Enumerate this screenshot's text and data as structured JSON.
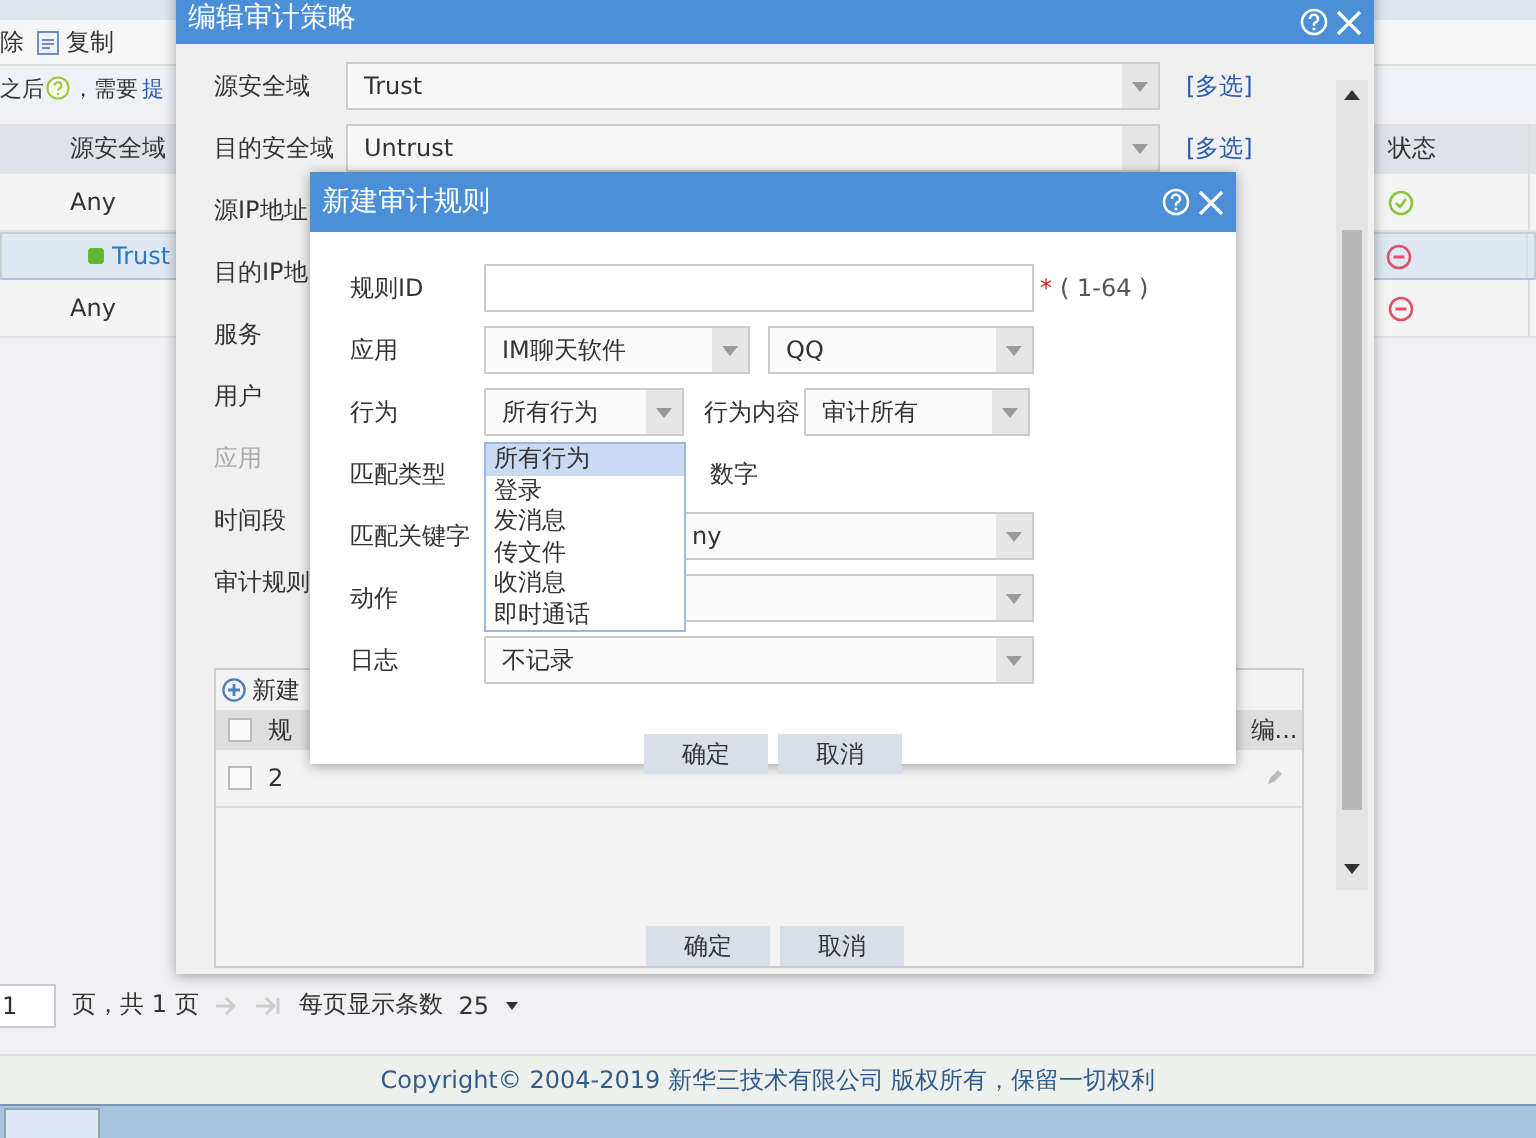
{
  "page": {
    "toolbar": [
      {
        "kind": "text",
        "label": "除"
      },
      {
        "kind": "copy",
        "label": "复制"
      }
    ],
    "notice": {
      "before": "之后",
      "after": "，需要",
      "link": "提"
    },
    "table": {
      "columns": [
        "源安全域",
        "状态"
      ],
      "rows": [
        {
          "zone": "Any",
          "zone_dot": false,
          "enabled": true,
          "selected": false
        },
        {
          "zone": "Trust",
          "zone_dot": true,
          "enabled": false,
          "selected": true
        },
        {
          "zone": "Any",
          "zone_dot": false,
          "enabled": false,
          "selected": false
        }
      ]
    },
    "pager": {
      "page": "1",
      "total": "页，共 1 页",
      "per_page_label": "每页显示条数",
      "per_page": "25"
    },
    "footer": "Copyright© 2004-2019 新华三技术有限公司 版权所有，保留一切权利"
  },
  "edit_dialog": {
    "title": "编辑审计策略",
    "fields": [
      {
        "label": "源安全域",
        "kind": "select",
        "value": "Trust",
        "link": "[多选]",
        "disabled": false
      },
      {
        "label": "目的安全域",
        "kind": "select",
        "value": "Untrust",
        "link": "[多选]",
        "disabled": false
      },
      {
        "label": "源IP地址",
        "kind": "label",
        "disabled": false
      },
      {
        "label": "目的IP地",
        "kind": "label",
        "disabled": false
      },
      {
        "label": "服务",
        "kind": "label",
        "disabled": false
      },
      {
        "label": "用户",
        "kind": "label",
        "disabled": false
      },
      {
        "label": "应用",
        "kind": "label",
        "disabled": true
      },
      {
        "label": "时间段",
        "kind": "label",
        "disabled": false
      },
      {
        "label": "审计规则",
        "kind": "label",
        "disabled": false
      }
    ],
    "rules_table": {
      "new_label": "新建",
      "columns": [
        "规",
        "编..."
      ],
      "header_checked": false,
      "rows": [
        {
          "id": "2",
          "checked": false
        }
      ]
    },
    "buttons": [
      "确定",
      "取消"
    ]
  },
  "new_rule_dialog": {
    "title": "新建审计规则",
    "rows": [
      {
        "kind": "input",
        "label": "规则ID",
        "required": "*",
        "hint": "( 1-64 )"
      },
      {
        "kind": "selects",
        "label": "应用",
        "values": [
          "IM聊天软件",
          "QQ"
        ]
      },
      {
        "kind": "behavior",
        "label": "行为",
        "value": "所有行为",
        "content_label": "行为内容",
        "content_value": "审计所有"
      },
      {
        "kind": "radio",
        "label": "匹配类型",
        "option": "数字"
      },
      {
        "kind": "select",
        "label": "匹配关键字",
        "value": "ny",
        "covered": true
      },
      {
        "kind": "select",
        "label": "动作"
      },
      {
        "kind": "select",
        "label": "日志",
        "value": "不记录",
        "covered": false
      }
    ],
    "dropdown": [
      {
        "label": "所有行为",
        "selected": true
      },
      {
        "label": "登录",
        "selected": false
      },
      {
        "label": "发消息",
        "selected": false
      },
      {
        "label": "传文件",
        "selected": false
      },
      {
        "label": "收消息",
        "selected": false
      },
      {
        "label": "即时通话",
        "selected": false
      }
    ],
    "buttons": [
      "确定",
      "取消"
    ]
  }
}
